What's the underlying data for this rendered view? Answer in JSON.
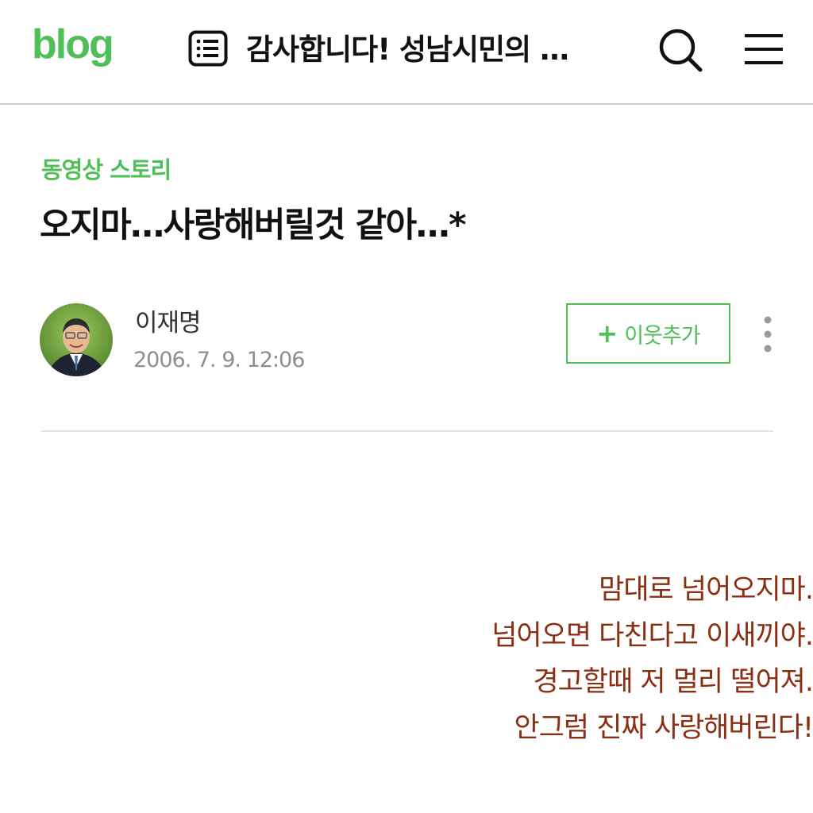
{
  "header": {
    "logo": "blog",
    "title": "감사합니다! 성남시민의 …",
    "icons": {
      "doc": "post-list-icon",
      "search": "search-icon",
      "menu": "menu-icon"
    }
  },
  "post": {
    "category": "동영상 스토리",
    "title": "오지마…사랑해버릴것 같아…*",
    "author": "이재명",
    "date": "2006. 7. 9. 12:06",
    "neighbor_button": {
      "plus": "+",
      "label": "이웃추가"
    },
    "poem": [
      "맘대로 넘어오지마.",
      "넘어오면 다친다고 이새끼야.",
      "경고할때 저 멀리 떨어져.",
      "안그럼 진짜 사랑해버린다!"
    ]
  },
  "colors": {
    "brand_green": "#4fbf58",
    "poem_text": "#8b2e12",
    "date_gray": "#8f8f8f",
    "divider": "#e4e4e4"
  }
}
